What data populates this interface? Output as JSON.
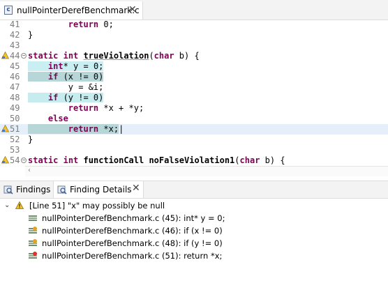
{
  "editor": {
    "tab_label": "nullPointerDerefBenchmark.c",
    "file_icon_letter": "c",
    "lines": [
      {
        "num": "41",
        "text": "        return 0;"
      },
      {
        "num": "42",
        "text": "}"
      },
      {
        "num": "43",
        "text": ""
      },
      {
        "num": "44",
        "text": "static int trueViolation(char b) {"
      },
      {
        "num": "45",
        "text": "    int* y = 0;"
      },
      {
        "num": "46",
        "text": "    if (x != 0)"
      },
      {
        "num": "47",
        "text": "        y = &i;"
      },
      {
        "num": "48",
        "text": "    if (y != 0)"
      },
      {
        "num": "49",
        "text": "        return *x + *y;"
      },
      {
        "num": "50",
        "text": "    else"
      },
      {
        "num": "51",
        "text": "        return *x;"
      },
      {
        "num": "52",
        "text": "}"
      },
      {
        "num": "53",
        "text": ""
      },
      {
        "num": "54",
        "text": "static int functionCall noFalseViolation1(char b) {"
      }
    ]
  },
  "views": {
    "findings_tab": "Findings",
    "details_tab": "Finding Details"
  },
  "details": {
    "root": "[Line 51] \"x\" may possibly be null",
    "items": [
      {
        "label": "nullPointerDerefBenchmark.c (45): int* y = 0;"
      },
      {
        "label": "nullPointerDerefBenchmark.c (46): if (x != 0)"
      },
      {
        "label": "nullPointerDerefBenchmark.c (48): if (y != 0)"
      },
      {
        "label": "nullPointerDerefBenchmark.c (51): return *x;"
      }
    ]
  },
  "colors": {
    "keyword": "#7f0055",
    "current_line": "#e4effa",
    "trace_highlight": "#b6d6d8"
  }
}
